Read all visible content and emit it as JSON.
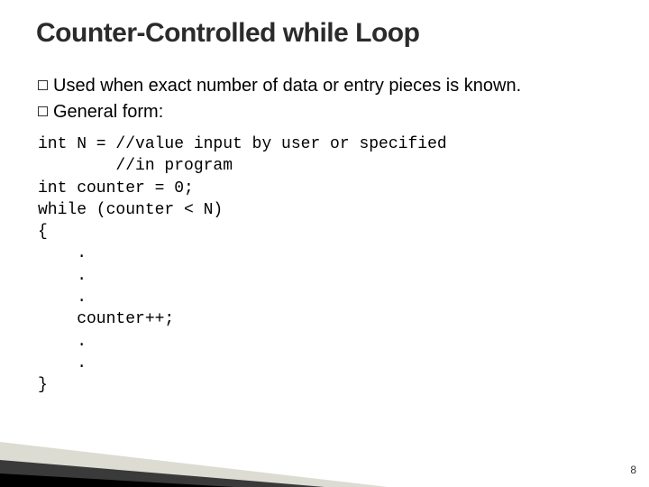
{
  "title": "Counter-Controlled while Loop",
  "bullets": {
    "b1_head": "Used",
    "b1_rest": " when exact number of data or entry pieces is known.",
    "b2_head": "General",
    "b2_rest": " form:"
  },
  "code": "int N = //value input by user or specified\n        //in program\nint counter = 0;\nwhile (counter < N)\n{\n    .\n    .\n    .\n    counter++;\n    .\n    .\n}",
  "page_number": "8"
}
